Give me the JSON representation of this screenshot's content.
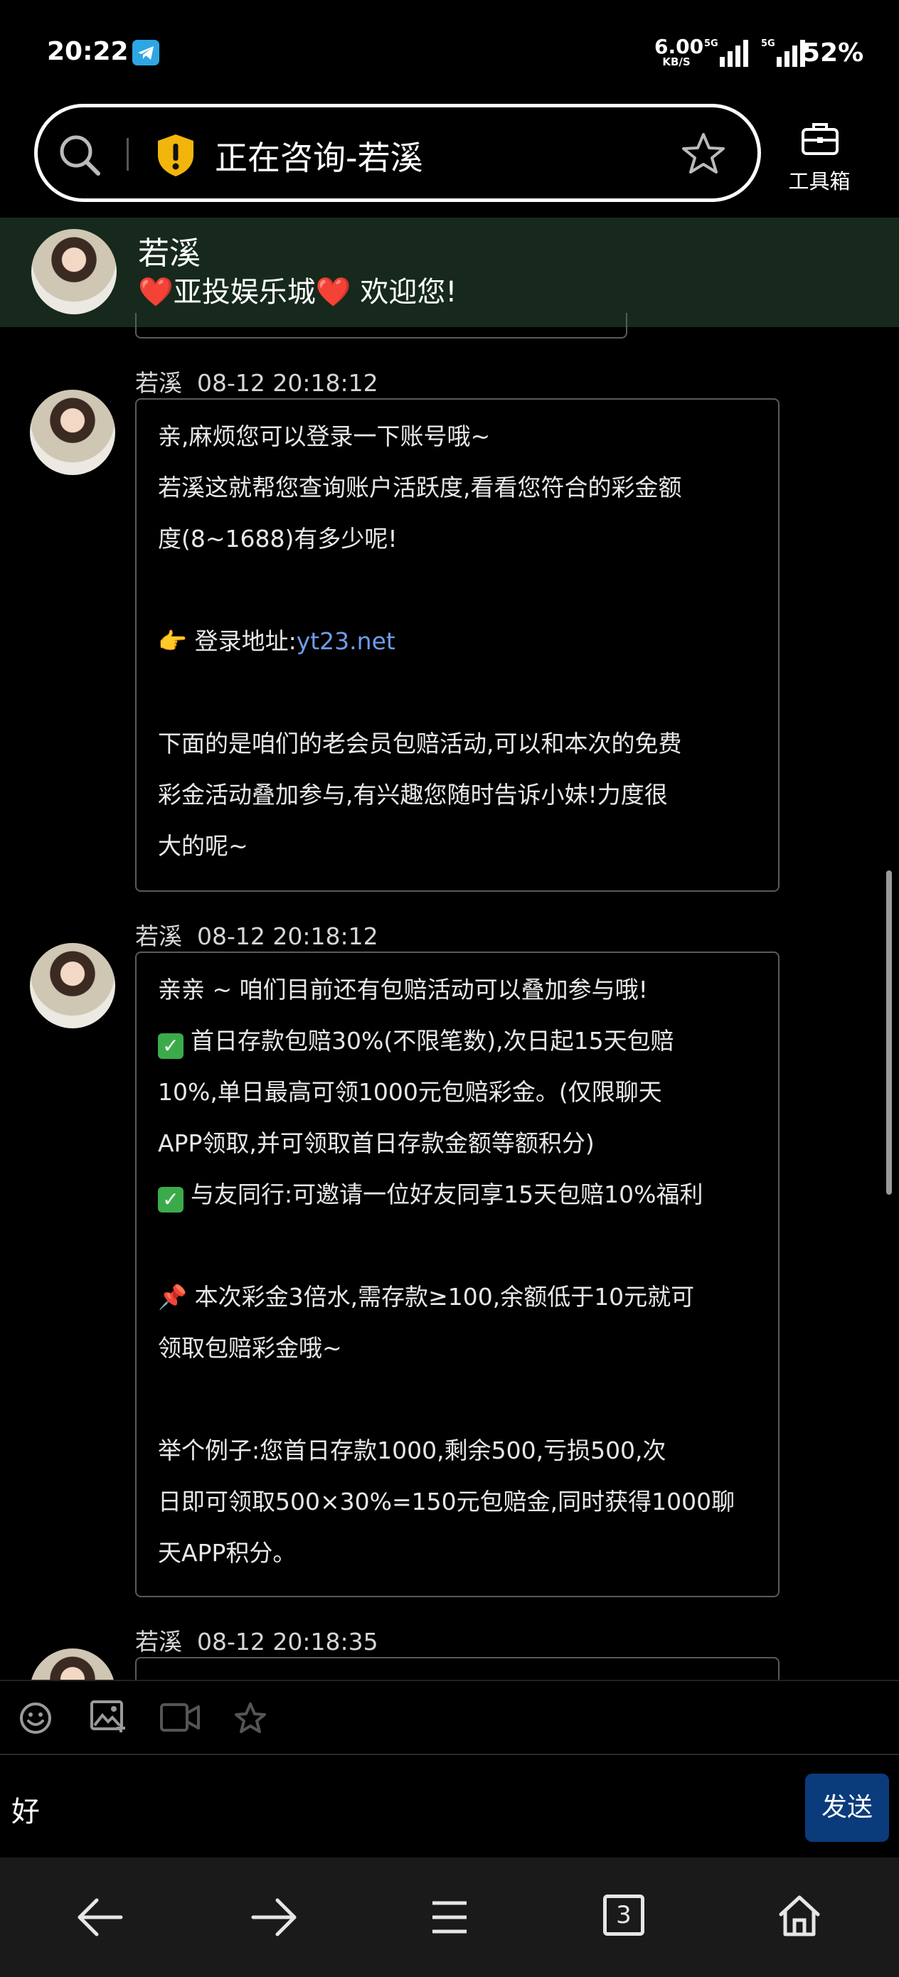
{
  "status_bar": {
    "time": "20:22",
    "net_speed_value": "6.00",
    "net_speed_unit": "KB/S",
    "signal_1_label": "5G",
    "signal_2_label": "5G",
    "battery": "52%"
  },
  "address_bar": {
    "title": "正在咨询-若溪",
    "toolbox_label": "工具箱"
  },
  "chat_header": {
    "name": "若溪",
    "welcome": "❤️亚投娱乐城❤️ 欢迎您!"
  },
  "messages": [
    {
      "sender": "若溪",
      "time": "08-12 20:18:12",
      "lines": [
        "亲,麻烦您可以登录一下账号哦~",
        "若溪这就帮您查询账户活跃度,看看您符合的彩金额",
        "度(8~1688)有多少呢!",
        "",
        "👉 登录地址:",
        "",
        "下面的是咱们的老会员包赔活动,可以和本次的免费",
        "彩金活动叠加参与,有兴趣您随时告诉小妹!力度很",
        "大的呢~"
      ],
      "link": "yt23.net"
    },
    {
      "sender": "若溪",
      "time": "08-12 20:18:12",
      "lines": [
        "亲亲 ~ 咱们目前还有包赔活动可以叠加参与哦!",
        "首日存款包赔30%(不限笔数),次日起15天包赔",
        "10%,单日最高可领1000元包赔彩金。(仅限聊天",
        "APP领取,并可领取首日存款金额等额积分)",
        "与友同行:可邀请一位好友同享15天包赔10%福利",
        "",
        "📌 本次彩金3倍水,需存款≥100,余额低于10元就可",
        "领取包赔彩金哦~",
        "",
        "举个例子:您首日存款1000,剩余500,亏损500,次",
        "日即可领取500×30%=150元包赔金,同时获得1000聊",
        "天APP积分。"
      ]
    },
    {
      "sender": "若溪",
      "time": "08-12 20:18:35"
    }
  ],
  "composer": {
    "input_value": "好",
    "send_label": "发送"
  },
  "nav_bar": {
    "tab_count": "3"
  },
  "colors": {
    "background": "#000000",
    "header_bg": "#16291c",
    "send_button": "#0a3b7b",
    "link": "#6d9eeb",
    "nav_bg": "#1a1a1a"
  }
}
